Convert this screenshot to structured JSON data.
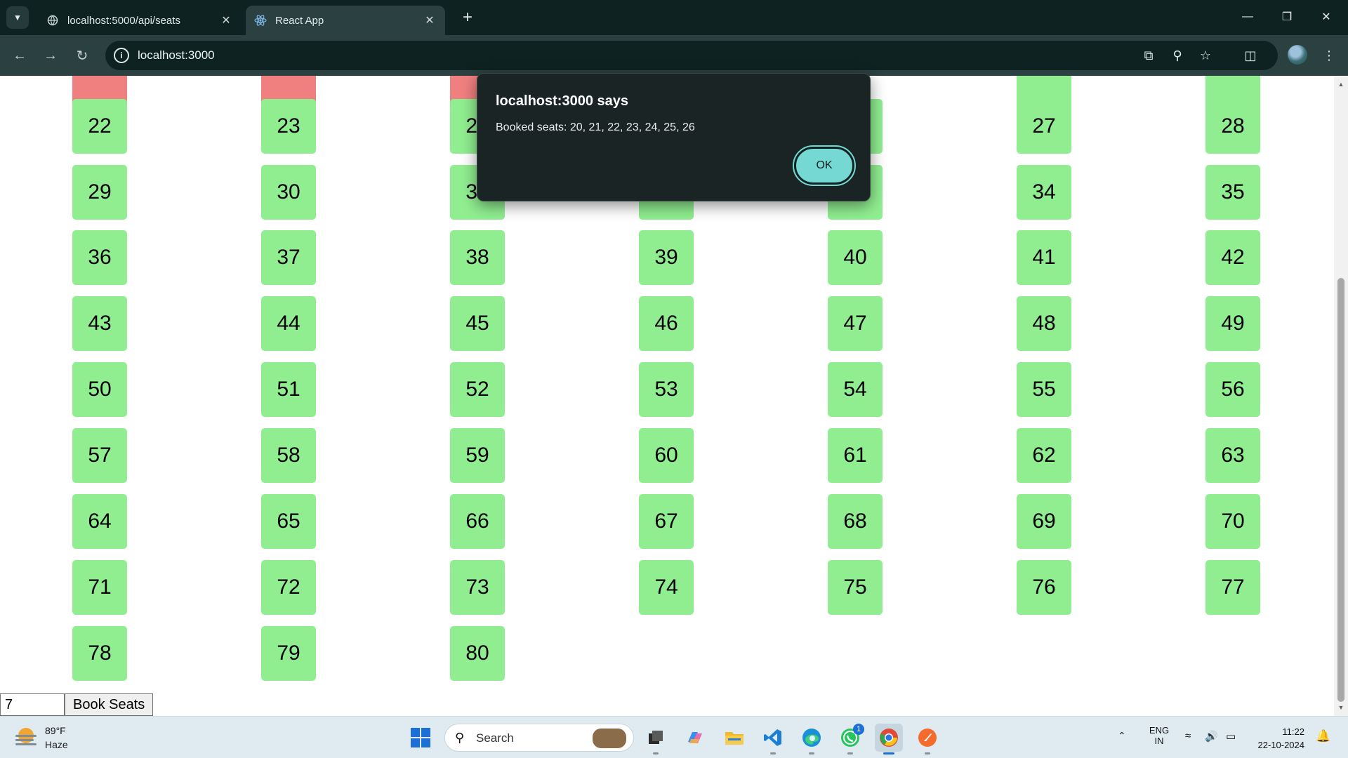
{
  "browser": {
    "tabs": [
      {
        "title": "localhost:5000/api/seats",
        "favicon": "globe-icon",
        "active": false
      },
      {
        "title": "React App",
        "favicon": "react-icon",
        "active": true
      }
    ],
    "address": "localhost:3000",
    "window_controls": [
      "minimize",
      "restore",
      "close"
    ]
  },
  "page": {
    "rows": [
      {
        "seats": [
          {
            "n": "",
            "booked": true
          },
          {
            "n": "",
            "booked": true
          },
          {
            "n": "",
            "booked": true
          },
          null,
          null,
          {
            "n": "",
            "booked": false
          },
          {
            "n": "",
            "booked": false
          }
        ]
      },
      {
        "seats": [
          {
            "n": "22",
            "booked": false
          },
          {
            "n": "23",
            "booked": false
          },
          {
            "n": "24",
            "booked": false
          },
          {
            "n": "25",
            "booked": false
          },
          {
            "n": "26",
            "booked": false
          },
          {
            "n": "27",
            "booked": false
          },
          {
            "n": "28",
            "booked": false
          }
        ]
      },
      {
        "seats": [
          {
            "n": "29",
            "booked": false
          },
          {
            "n": "30",
            "booked": false
          },
          {
            "n": "31",
            "booked": false
          },
          {
            "n": "32",
            "booked": false
          },
          {
            "n": "33",
            "booked": false
          },
          {
            "n": "34",
            "booked": false
          },
          {
            "n": "35",
            "booked": false
          }
        ]
      },
      {
        "seats": [
          {
            "n": "36",
            "booked": false
          },
          {
            "n": "37",
            "booked": false
          },
          {
            "n": "38",
            "booked": false
          },
          {
            "n": "39",
            "booked": false
          },
          {
            "n": "40",
            "booked": false
          },
          {
            "n": "41",
            "booked": false
          },
          {
            "n": "42",
            "booked": false
          }
        ]
      },
      {
        "seats": [
          {
            "n": "43",
            "booked": false
          },
          {
            "n": "44",
            "booked": false
          },
          {
            "n": "45",
            "booked": false
          },
          {
            "n": "46",
            "booked": false
          },
          {
            "n": "47",
            "booked": false
          },
          {
            "n": "48",
            "booked": false
          },
          {
            "n": "49",
            "booked": false
          }
        ]
      },
      {
        "seats": [
          {
            "n": "50",
            "booked": false
          },
          {
            "n": "51",
            "booked": false
          },
          {
            "n": "52",
            "booked": false
          },
          {
            "n": "53",
            "booked": false
          },
          {
            "n": "54",
            "booked": false
          },
          {
            "n": "55",
            "booked": false
          },
          {
            "n": "56",
            "booked": false
          }
        ]
      },
      {
        "seats": [
          {
            "n": "57",
            "booked": false
          },
          {
            "n": "58",
            "booked": false
          },
          {
            "n": "59",
            "booked": false
          },
          {
            "n": "60",
            "booked": false
          },
          {
            "n": "61",
            "booked": false
          },
          {
            "n": "62",
            "booked": false
          },
          {
            "n": "63",
            "booked": false
          }
        ]
      },
      {
        "seats": [
          {
            "n": "64",
            "booked": false
          },
          {
            "n": "65",
            "booked": false
          },
          {
            "n": "66",
            "booked": false
          },
          {
            "n": "67",
            "booked": false
          },
          {
            "n": "68",
            "booked": false
          },
          {
            "n": "69",
            "booked": false
          },
          {
            "n": "70",
            "booked": false
          }
        ]
      },
      {
        "seats": [
          {
            "n": "71",
            "booked": false
          },
          {
            "n": "72",
            "booked": false
          },
          {
            "n": "73",
            "booked": false
          },
          {
            "n": "74",
            "booked": false
          },
          {
            "n": "75",
            "booked": false
          },
          {
            "n": "76",
            "booked": false
          },
          {
            "n": "77",
            "booked": false
          }
        ]
      },
      {
        "seats": [
          {
            "n": "78",
            "booked": false
          },
          {
            "n": "79",
            "booked": false
          },
          {
            "n": "80",
            "booked": false
          }
        ]
      }
    ],
    "seat_count_input": "7",
    "book_button": "Book Seats",
    "colors": {
      "available": "#90ee90",
      "booked": "#f08080"
    }
  },
  "alert": {
    "title": "localhost:3000 says",
    "message": "Booked seats: 20, 21, 22, 23, 24, 25, 26",
    "ok_label": "OK"
  },
  "taskbar": {
    "weather": {
      "temp": "89°F",
      "condition": "Haze"
    },
    "search_placeholder": "Search",
    "apps": [
      "task-view",
      "copilot",
      "file-explorer",
      "vscode",
      "edge",
      "whatsapp",
      "chrome",
      "postman"
    ],
    "whatsapp_badge": "1",
    "language": {
      "line1": "ENG",
      "line2": "IN"
    },
    "time": "11:22",
    "date": "22-10-2024"
  }
}
